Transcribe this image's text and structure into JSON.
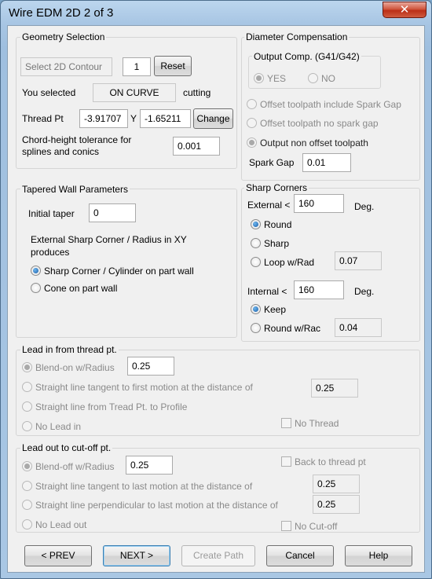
{
  "window": {
    "title": "Wire EDM 2D 2 of 3",
    "close_symbol": "✕"
  },
  "geometry": {
    "title": "Geometry Selection",
    "select_contour": "Select 2D Contour",
    "count": "1",
    "reset": "Reset",
    "you_selected": "You selected",
    "selection_value": "ON CURVE",
    "cutting": "cutting",
    "thread_pt": "Thread Pt",
    "x_value": "-3.91707",
    "y_label": "Y",
    "y_value": "-1.65211",
    "change": "Change",
    "chord_line1": "Chord-height tolerance for",
    "chord_line2": "splines and conics",
    "chord_value": "0.001"
  },
  "diameter": {
    "title": "Diameter Compensation",
    "output_comp_title": "Output Comp.  (G41/G42)",
    "yes": "YES",
    "no": "NO",
    "opt1": "Offset toolpath include Spark Gap",
    "opt2": "Offset toolpath no spark gap",
    "opt3": "Output non offset toolpath",
    "spark_gap_label": "Spark Gap",
    "spark_gap_value": "0.01"
  },
  "tapered": {
    "title": "Tapered Wall Parameters",
    "initial_taper_label": "Initial taper",
    "initial_taper_value": "0",
    "produces_line1": "External Sharp Corner / Radius in XY",
    "produces_line2": "produces",
    "opt_cylinder": "Sharp Corner / Cylinder on part wall",
    "opt_cone": "Cone on part wall"
  },
  "sharp": {
    "title": "Sharp Corners",
    "external_label": "External <",
    "external_value": "160",
    "deg1": "Deg.",
    "round": "Round",
    "sharp": "Sharp",
    "loop": "Loop w/Rad",
    "loop_value": "0.07",
    "internal_label": "Internal <",
    "internal_value": "160",
    "deg2": "Deg.",
    "keep": "Keep",
    "round_rad": "Round w/Rac",
    "round_rad_value": "0.04"
  },
  "leadin": {
    "title": "Lead in from thread pt.",
    "blend": "Blend-on w/Radius",
    "blend_value": "0.25",
    "tangent": "Straight line tangent to first motion at the distance of",
    "tangent_value": "0.25",
    "from_thread": "Straight line from Tread Pt. to Profile",
    "no_lead": "No Lead in",
    "no_thread": "No Thread"
  },
  "leadout": {
    "title": "Lead out to cut-off pt.",
    "blend": "Blend-off w/Radius",
    "blend_value": "0.25",
    "back_thread": "Back to thread pt",
    "tangent": "Straight line tangent to last motion at the distance of",
    "tangent_value": "0.25",
    "perp": "Straight line perpendicular to last motion at the distance of",
    "perp_value": "0.25",
    "no_lead": "No Lead out",
    "no_cutoff": "No Cut-off"
  },
  "buttons": {
    "prev": "< PREV",
    "next": "NEXT >",
    "create": "Create Path",
    "cancel": "Cancel",
    "help": "Help"
  }
}
